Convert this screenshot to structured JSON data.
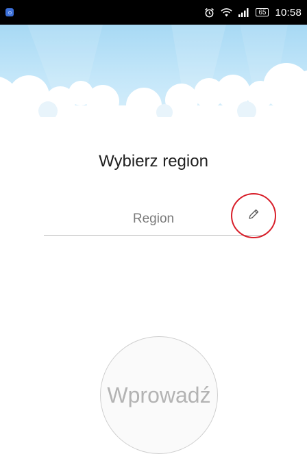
{
  "status_bar": {
    "battery": "65",
    "time": "10:58",
    "icons": [
      "app-notification-icon",
      "alarm-icon",
      "wifi-icon",
      "signal-icon",
      "battery-icon"
    ]
  },
  "header": {
    "background": "sky-with-clouds",
    "sky_color": "#a7d9f4"
  },
  "main": {
    "title": "Wybierz region",
    "region_placeholder": "Region",
    "edit_icon": "pencil-icon",
    "highlight_color": "#d81f2a",
    "enter_button_label": "Wprowadź"
  }
}
